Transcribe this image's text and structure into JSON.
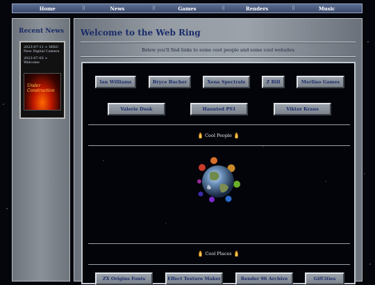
{
  "nav": {
    "items": [
      "Home",
      "News",
      "Games",
      "Renders",
      "Music"
    ]
  },
  "sidebar": {
    "title": "Recent News",
    "news": [
      "2023-07-11 > MISC New Digital Camera",
      "2023-07-03 > Welcome"
    ],
    "banner": {
      "line1": "Under",
      "line2": "Construction"
    }
  },
  "main": {
    "title": "Welcome to the Web Ring",
    "subtitle": "Below you'll find links to some cool people and some cool websites",
    "people_row1": [
      "Ian Williams",
      "Bryce Bucher",
      "Xena Spectrale",
      "Z Bill",
      "Merlino Games"
    ],
    "people_row2": [
      "Valerie Dusk",
      "Haunted PS1",
      "Viktor Kraus"
    ],
    "cool_people_label": "Cool People",
    "cool_places_label": "Cool Places",
    "places": [
      "ZX Origins Fonts",
      "Effect Texture Maker",
      "Render 96 Archive",
      "GifCities"
    ]
  },
  "colors": {
    "heading": "#1a2b68",
    "nav_bg": "#3b4a6b",
    "panel_bg": "#03040a"
  }
}
